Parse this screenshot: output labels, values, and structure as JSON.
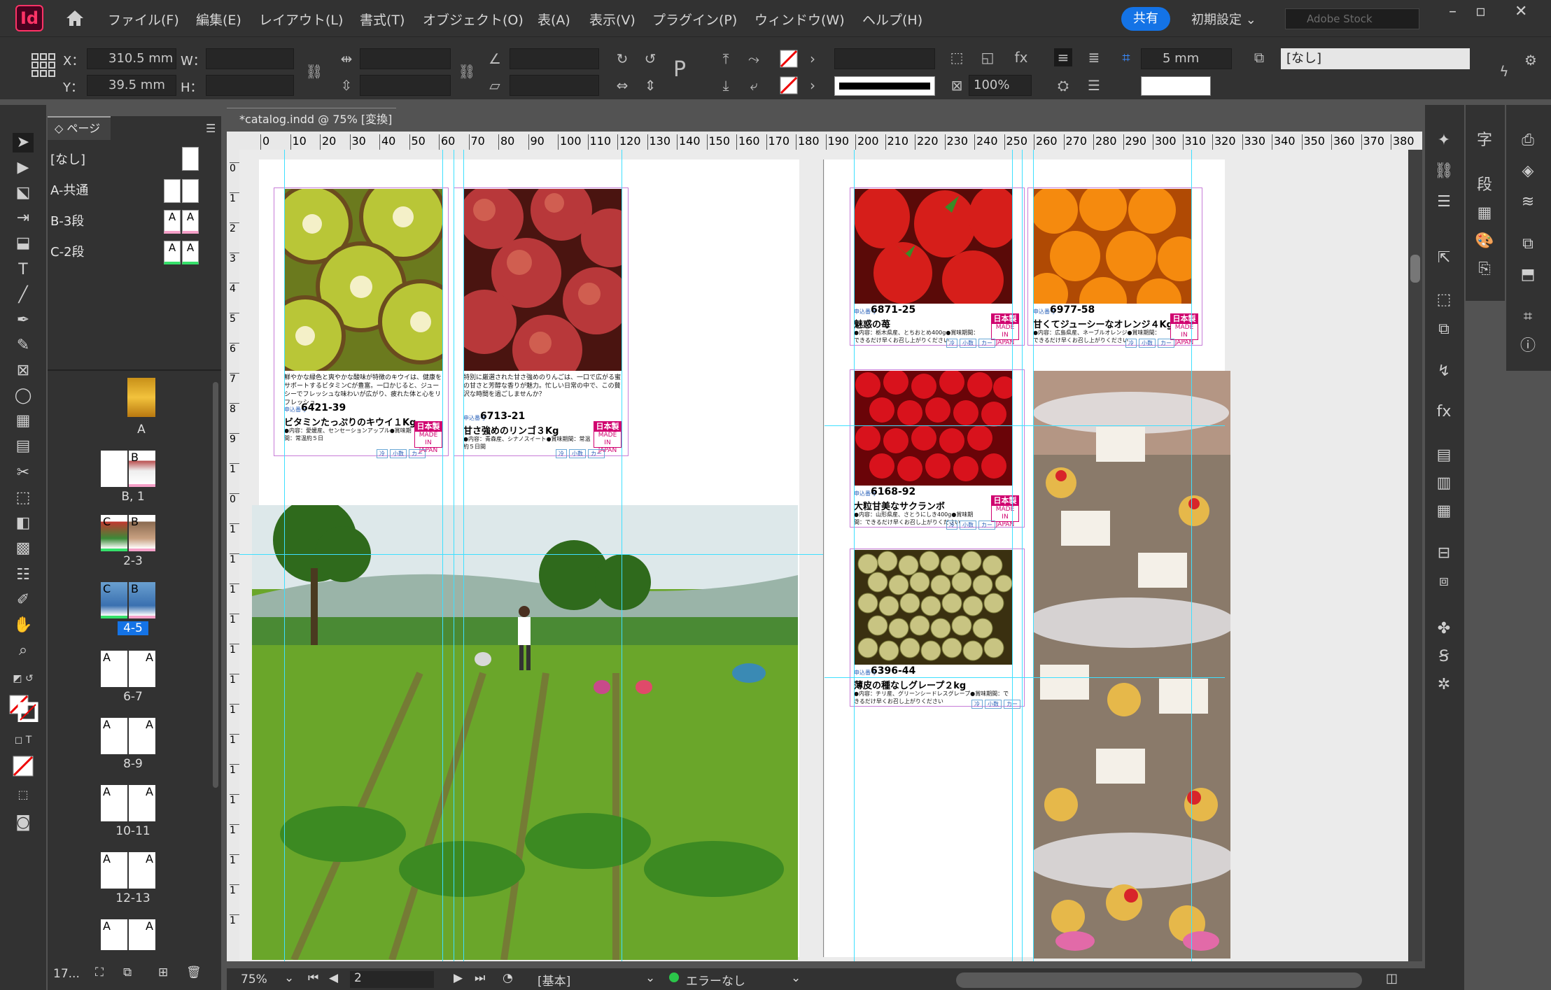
{
  "app": {
    "logo": "Id",
    "home_icon": "home-icon"
  },
  "menu": [
    "ファイル(F)",
    "編集(E)",
    "レイアウト(L)",
    "書式(T)",
    "オブジェクト(O)",
    "表(A)",
    "表示(V)",
    "プラグイン(P)",
    "ウィンドウ(W)",
    "ヘルプ(H)"
  ],
  "topright": {
    "share": "共有",
    "workspace": "初期設定",
    "stock_placeholder": "Adobe Stock"
  },
  "control": {
    "x_label": "X：",
    "x_value": "310.5 mm",
    "y_label": "Y：",
    "y_value": "39.5 mm",
    "w_label": "W：",
    "h_label": "H：",
    "stroke_weight": "5 mm",
    "opacity": "100%",
    "style": "[なし]"
  },
  "document": {
    "tab": "*catalog.indd @ 75% [変換]"
  },
  "ruler": {
    "h_ticks": [
      "0",
      "10",
      "20",
      "30",
      "40",
      "50",
      "60",
      "70",
      "80",
      "90",
      "100",
      "110",
      "120",
      "130",
      "140",
      "150",
      "160",
      "170",
      "180",
      "190",
      "200",
      "210",
      "220",
      "230",
      "240",
      "250",
      "260",
      "270",
      "280",
      "290",
      "300",
      "310",
      "320",
      "330",
      "340",
      "350",
      "360",
      "370",
      "380"
    ],
    "v_ticks": [
      "0",
      "1",
      "2",
      "3",
      "4",
      "5",
      "6",
      "7",
      "8",
      "9",
      "1",
      "0",
      "1",
      "1",
      "1",
      "1",
      "1",
      "1",
      "1",
      "1",
      "1",
      "1",
      "1",
      "1",
      "1",
      "1"
    ]
  },
  "pages_panel": {
    "tab": "ページ",
    "masters": [
      {
        "name": "[なし]"
      },
      {
        "name": "A-共通"
      },
      {
        "name": "B-3段",
        "letter": "A"
      },
      {
        "name": "C-2段",
        "letter": "A"
      }
    ],
    "spreads": [
      {
        "label": "A"
      },
      {
        "label": "B, 1",
        "letter": "B"
      },
      {
        "label": "2-3",
        "letter_l": "C",
        "letter_r": "B"
      },
      {
        "label": "4-5",
        "letter_l": "C",
        "letter_r": "B"
      },
      {
        "label": "6-7",
        "letter_l": "A",
        "letter_r": "A"
      },
      {
        "label": "8-9",
        "letter_l": "A",
        "letter_r": "A"
      },
      {
        "label": "10-11",
        "letter_l": "A",
        "letter_r": "A"
      },
      {
        "label": "12-13",
        "letter_l": "A",
        "letter_r": "A"
      },
      {
        "letter_l": "A",
        "letter_r": "A"
      }
    ],
    "footer": "17..."
  },
  "products": [
    {
      "desc": "鮮やかな緑色と爽やかな酸味が特徴のキウイは、健康をサポートするビタミンCが豊富。一口かじると、ジューシーでフレッシュな味わいが広がり、疲れた体と心をリフレッシュ。",
      "tag": "申込番号",
      "code": "6421-39",
      "name": "ビタミンたっぷりのキウイ１Kg",
      "detail": "●内容：愛媛産、センセーションアップル●賞味期間：常温約５日",
      "badge_top": "日本製",
      "badge_bottom": "MADE IN JAPAN",
      "chips": [
        "冷",
        "小数",
        "カー"
      ]
    },
    {
      "desc": "特別に厳選された甘さ強めのりんごは、一口で広がる蜜の甘さと芳醇な香りが魅力。忙しい日常の中で、この贅沢な時間を過ごしませんか？",
      "tag": "申込番号",
      "code": "6713-21",
      "name": "甘さ強めのリンゴ３Kg",
      "detail": "●内容：青森産、シナノスイート●賞味期間：常温約５日間",
      "badge_top": "日本製",
      "badge_bottom": "MADE IN JAPAN",
      "chips": [
        "冷",
        "小数",
        "カー"
      ]
    },
    {
      "tag": "申込番号",
      "code": "6871-25",
      "name": "魅惑の苺",
      "detail": "●内容：栃木県産、とちおとめ400g●賞味期間：できるだけ早くお召し上がりください",
      "badge_top": "日本製",
      "badge_bottom": "MADE IN JAPAN",
      "chips": [
        "冷",
        "小数",
        "カー"
      ]
    },
    {
      "tag": "申込番号",
      "code": "6977-58",
      "name": "甘くてジューシーなオレンジ４Kg",
      "detail": "●内容：広島県産、ネーブルオレンジ●賞味期間：できるだけ早くお召し上がりください",
      "badge_top": "日本製",
      "badge_bottom": "MADE IN JAPAN",
      "chips": [
        "冷",
        "小数",
        "カー"
      ]
    },
    {
      "tag": "申込番号",
      "code": "6168-92",
      "name": "大粒甘美なサクランボ",
      "detail": "●内容：山形県産、さとうにしき400g●賞味期間：できるだけ早くお召し上がりください",
      "badge_top": "日本製",
      "badge_bottom": "MADE IN JAPAN",
      "chips": [
        "冷",
        "小数",
        "カー"
      ]
    },
    {
      "tag": "申込番号",
      "code": "6396-44",
      "name": "薄皮の種なしグレープ２kg",
      "detail": "●内容：チリ産、グリーンシードレスグレープ●賞味期間：できるだけ早くお召し上がりください",
      "chips": [
        "冷",
        "小数",
        "カー"
      ]
    }
  ],
  "status": {
    "zoom": "75%",
    "page": "2",
    "master": "[基本]",
    "preflight": "エラーなし"
  }
}
